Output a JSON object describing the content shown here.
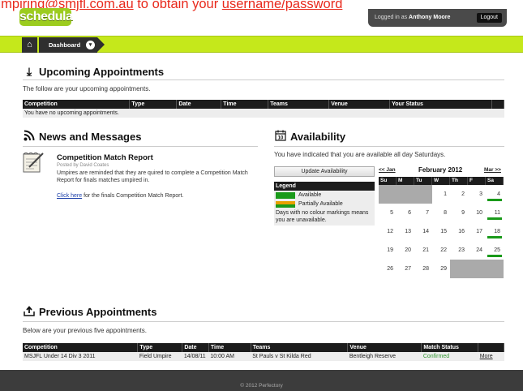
{
  "banner": {
    "prefix": "umpiring@",
    "email_text": "smjfl.com.au",
    "suffix": " to obtain your ",
    "link_text": "username/password"
  },
  "logo": {
    "text": "schedula"
  },
  "user": {
    "prefix": "Logged in as ",
    "name": "Anthony Moore",
    "logout_label": "Logout"
  },
  "nav": {
    "dashboard_label": "Dashboard",
    "home_icon": "home-icon",
    "chevron_icon": "chevron-down-icon"
  },
  "upcoming": {
    "title": "Upcoming Appointments",
    "description": "The follow are your upcoming appointments.",
    "columns": [
      "Competition",
      "Type",
      "Date",
      "Time",
      "Teams",
      "Venue",
      "Your Status"
    ],
    "empty_message": "You have no upcoming appointments."
  },
  "news": {
    "title": "News and Messages",
    "item": {
      "title": "Competition Match Report",
      "meta": "Posted by David Coates",
      "body": "Umpires are reminded that they are quired to complete a Competition Match Report for finals matches umpired in.",
      "link_text": "Click here",
      "link_suffix": " for the finals Competition Match Report."
    }
  },
  "availability": {
    "title": "Availability",
    "description": "You have indicated that you are available all day Saturdays.",
    "update_button": "Update Availability",
    "legend": {
      "title": "Legend",
      "available": "Available",
      "partial": "Partially Available",
      "note": "Days with no colour markings means you are unavailable."
    },
    "calendar": {
      "prev": "<< Jan",
      "next": "Mar >>",
      "month": "February 2012",
      "day_headers": [
        "Su",
        "M",
        "Tu",
        "W",
        "Th",
        "F",
        "Sa"
      ],
      "weeks": [
        [
          {
            "d": "",
            "grey": true
          },
          {
            "d": "",
            "grey": true
          },
          {
            "d": "",
            "grey": true
          },
          {
            "d": "1"
          },
          {
            "d": "2"
          },
          {
            "d": "3"
          },
          {
            "d": "4",
            "available": true
          }
        ],
        [
          {
            "d": "5"
          },
          {
            "d": "6"
          },
          {
            "d": "7"
          },
          {
            "d": "8"
          },
          {
            "d": "9"
          },
          {
            "d": "10"
          },
          {
            "d": "11",
            "available": true
          }
        ],
        [
          {
            "d": "12"
          },
          {
            "d": "13"
          },
          {
            "d": "14"
          },
          {
            "d": "15"
          },
          {
            "d": "16"
          },
          {
            "d": "17"
          },
          {
            "d": "18",
            "available": true
          }
        ],
        [
          {
            "d": "19"
          },
          {
            "d": "20"
          },
          {
            "d": "21"
          },
          {
            "d": "22"
          },
          {
            "d": "23"
          },
          {
            "d": "24"
          },
          {
            "d": "25",
            "available": true
          }
        ],
        [
          {
            "d": "26"
          },
          {
            "d": "27"
          },
          {
            "d": "28"
          },
          {
            "d": "29"
          },
          {
            "d": "",
            "grey": true
          },
          {
            "d": "",
            "grey": true
          },
          {
            "d": "",
            "grey": true
          }
        ]
      ]
    },
    "colors": {
      "available": "#1a9a1a",
      "partial": "#e8a000"
    }
  },
  "previous": {
    "title": "Previous Appointments",
    "description": "Below are your previous five appointments.",
    "columns": [
      "Competition",
      "Type",
      "Date",
      "Time",
      "Teams",
      "Venue",
      "Match Status",
      ""
    ],
    "rows": [
      {
        "competition": "MSJFL Under 14 Div 3 2011",
        "type": "Field Umpire",
        "date": "14/08/11",
        "time": "10:00 AM",
        "teams": "St Pauls v St Kilda Red",
        "venue": "Bentleigh Reserve",
        "status": "Confirmed",
        "more": "More"
      }
    ]
  },
  "footer": {
    "text": "© 2012 Perfectory"
  },
  "colors": {
    "nav_green": "#c5e81b",
    "logo_green": "#9ccc1e",
    "dark": "#1c1c1c"
  }
}
